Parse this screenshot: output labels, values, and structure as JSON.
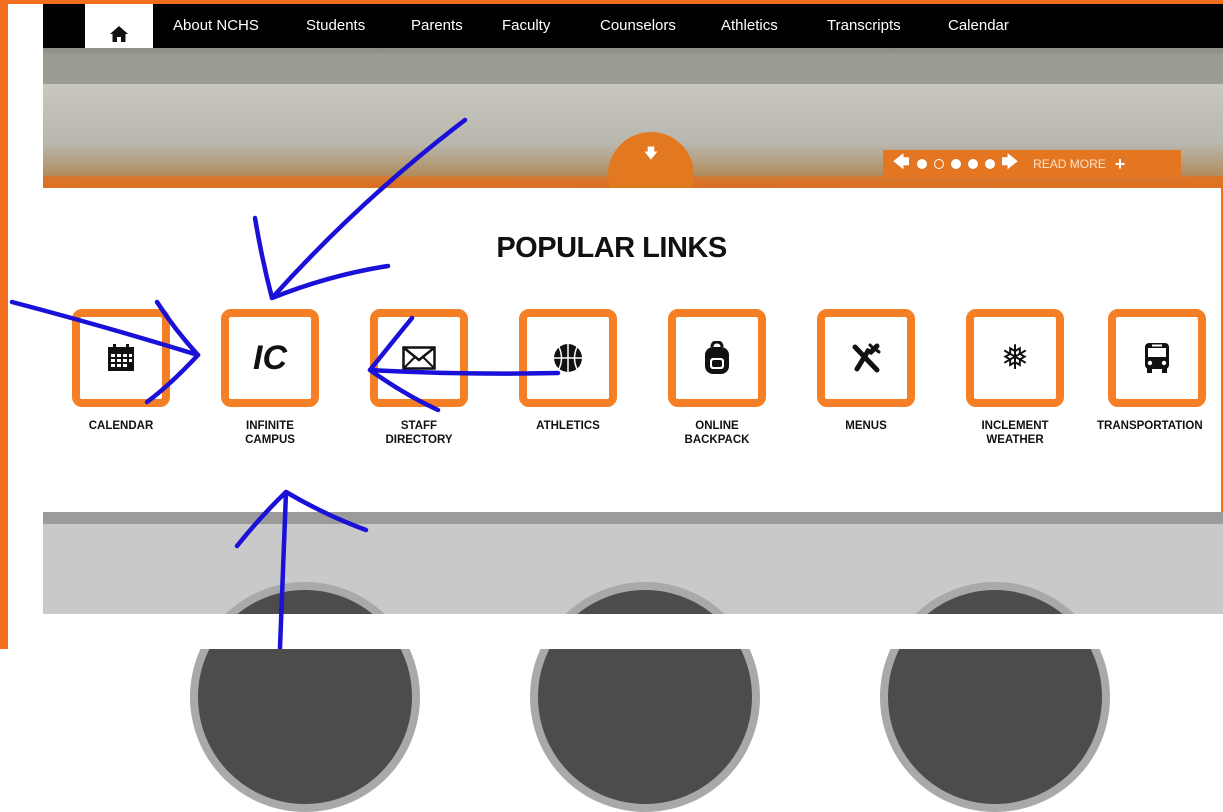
{
  "nav": {
    "home_icon": "home-icon",
    "items": [
      "About NCHS",
      "Students",
      "Parents",
      "Faculty",
      "Counselors",
      "Athletics",
      "Transcripts",
      "Calendar"
    ]
  },
  "hero": {
    "scroll_icon": "arrow-down-icon",
    "read_more": "READ MORE"
  },
  "popular_links": {
    "title": "POPULAR LINKS",
    "items": [
      {
        "label_1": "CALENDAR",
        "label_2": "",
        "icon": "calendar-icon"
      },
      {
        "label_1": "INFINITE",
        "label_2": "CAMPUS",
        "icon": "ic-text-icon",
        "glyph": "IC"
      },
      {
        "label_1": "STAFF",
        "label_2": "DIRECTORY",
        "icon": "envelope-icon"
      },
      {
        "label_1": "ATHLETICS",
        "label_2": "",
        "icon": "basketball-icon"
      },
      {
        "label_1": "ONLINE",
        "label_2": "BACKPACK",
        "icon": "backpack-icon"
      },
      {
        "label_1": "MENUS",
        "label_2": "",
        "icon": "fork-knife-icon"
      },
      {
        "label_1": "INCLEMENT",
        "label_2": "WEATHER",
        "icon": "snowflake-icon"
      },
      {
        "label_1": "TRANSPORTATION",
        "label_2": "",
        "icon": "bus-icon"
      }
    ]
  },
  "colors": {
    "accent": "#f47f24",
    "nav_bg": "#000000",
    "annotation": "#1a10d8"
  }
}
